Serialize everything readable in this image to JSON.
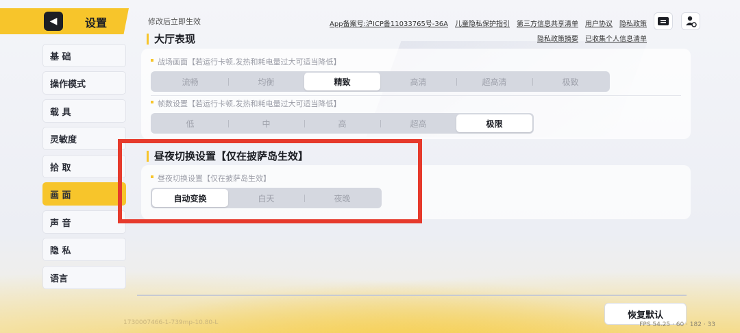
{
  "header": {
    "title": "设置"
  },
  "sidebar": {
    "items": [
      {
        "label": "基 础",
        "active": false
      },
      {
        "label": "操作模式",
        "active": false
      },
      {
        "label": "载 具",
        "active": false
      },
      {
        "label": "灵敏度",
        "active": false
      },
      {
        "label": "拾 取",
        "active": false
      },
      {
        "label": "画 面",
        "active": true
      },
      {
        "label": "声 音",
        "active": false
      },
      {
        "label": "隐 私",
        "active": false
      },
      {
        "label": "语言",
        "active": false
      }
    ]
  },
  "topbar": {
    "hint": "修改后立即生效",
    "links_row1": [
      "App备案号:沪ICP备11033765号-36A",
      "儿童隐私保护指引",
      "第三方信息共享清单",
      "用户协议",
      "隐私政策"
    ],
    "links_row2": [
      "隐私政策摘要",
      "已收集个人信息清单"
    ]
  },
  "lobby": {
    "title": "大厅表现",
    "battle_label": "战场画面【若运行卡顿,发热和耗电量过大可适当降低】",
    "battle_options": [
      "流畅",
      "均衡",
      "精致",
      "高清",
      "超高清",
      "极致"
    ],
    "battle_selected": "精致",
    "fps_label": "帧数设置【若运行卡顿,发热和耗电量过大可适当降低】",
    "fps_options": [
      "低",
      "中",
      "高",
      "超高",
      "极限"
    ],
    "fps_selected": "极限"
  },
  "daynight": {
    "title": "昼夜切换设置【仅在披萨岛生效】",
    "label": "昼夜切换设置【仅在披萨岛生效】",
    "options": [
      "自动变换",
      "白天",
      "夜晚"
    ],
    "selected": "自动变换"
  },
  "footer": {
    "reset_label": "恢复默认",
    "build_info": "1730007466-1-739mp-10.80-L",
    "fps_info": "FPS 54.25 · 60 · 182 · 33"
  },
  "colors": {
    "accent": "#f7c52b",
    "highlight": "#e63a2c"
  },
  "icons": {
    "back": "back-arrow-icon",
    "ticket": "ticket-icon",
    "profile": "profile-settings-icon"
  }
}
